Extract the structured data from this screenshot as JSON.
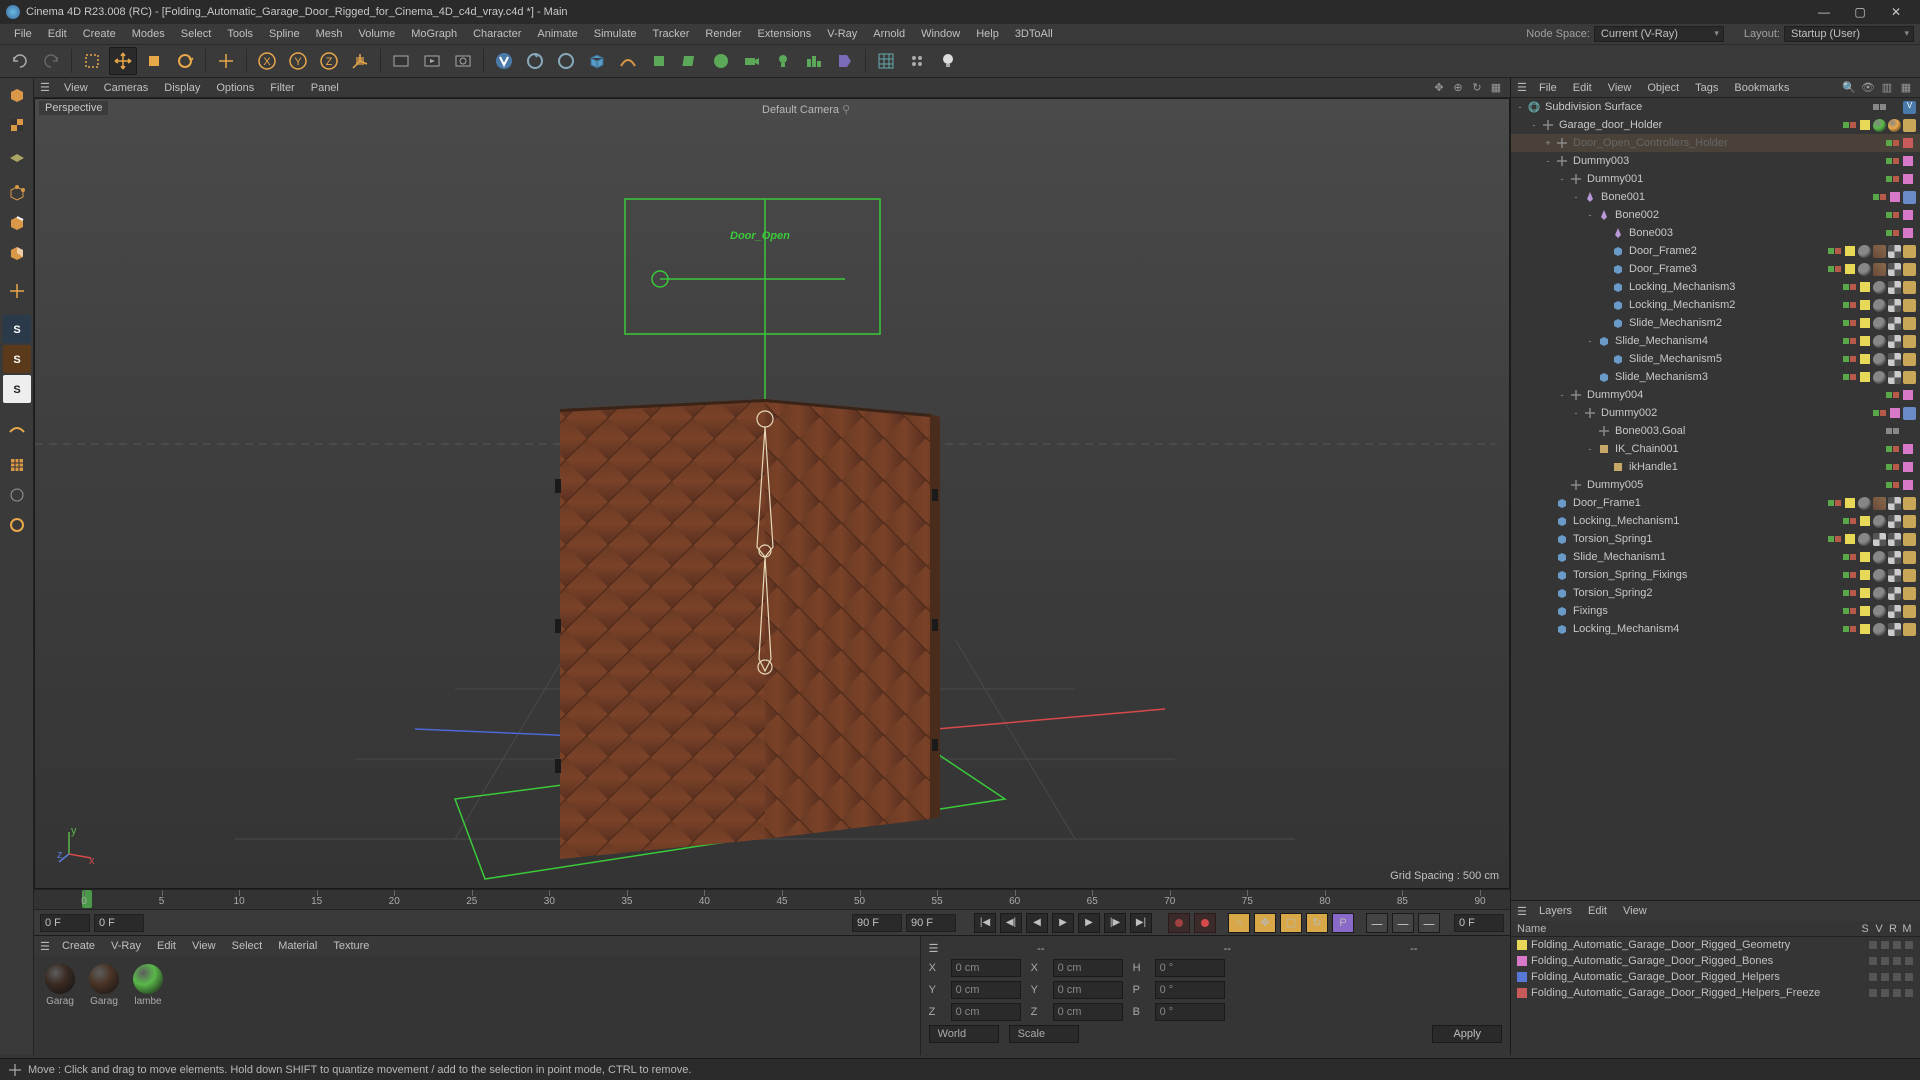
{
  "title": "Cinema 4D R23.008 (RC) - [Folding_Automatic_Garage_Door_Rigged_for_Cinema_4D_c4d_vray.c4d *] - Main",
  "main_menu": [
    "File",
    "Edit",
    "Create",
    "Modes",
    "Select",
    "Tools",
    "Spline",
    "Mesh",
    "Volume",
    "MoGraph",
    "Character",
    "Animate",
    "Simulate",
    "Tracker",
    "Render",
    "Extensions",
    "V-Ray",
    "Arnold",
    "Window",
    "Help",
    "3DToAll"
  ],
  "nodespace_label": "Node Space:",
  "nodespace_value": "Current (V-Ray)",
  "layout_label": "Layout:",
  "layout_value": "Startup (User)",
  "viewport_menu": [
    "View",
    "Cameras",
    "Display",
    "Options",
    "Filter",
    "Panel"
  ],
  "viewport_label": "Perspective",
  "viewport_camera": "Default Camera",
  "viewport_overlay_text": "Door_Open",
  "grid_spacing": "Grid Spacing : 500 cm",
  "timeline": {
    "start_field": "0 F",
    "start_field2": "0 F",
    "end_field": "90 F",
    "end_field2": "90 F",
    "cur_frame": "0 F",
    "ticks": [
      0,
      5,
      10,
      15,
      20,
      25,
      30,
      35,
      40,
      45,
      50,
      55,
      60,
      65,
      70,
      75,
      80,
      85,
      90
    ]
  },
  "material_menu": [
    "Create",
    "V-Ray",
    "Edit",
    "View",
    "Select",
    "Material",
    "Texture"
  ],
  "materials": [
    {
      "name": "Garag",
      "color": "#3a2a22"
    },
    {
      "name": "Garag",
      "color": "#4a3426"
    },
    {
      "name": "lambe",
      "color": "#5ab84a"
    }
  ],
  "coords": {
    "pos": {
      "X": "0 cm",
      "Y": "0 cm",
      "Z": "0 cm"
    },
    "size": {
      "X": "0 cm",
      "Y": "0 cm",
      "Z": "0 cm"
    },
    "rot": {
      "H": "0 °",
      "P": "0 °",
      "B": "0 °"
    },
    "world": "World",
    "scale": "Scale",
    "apply": "Apply"
  },
  "om_menu": [
    "File",
    "Edit",
    "View",
    "Object",
    "Tags",
    "Bookmarks"
  ],
  "om_tree": [
    {
      "indent": 0,
      "toggle": "-",
      "icon": "subdiv",
      "name": "Subdivision Surface",
      "layer": "",
      "dots": "grey",
      "tags": [
        "vray"
      ]
    },
    {
      "indent": 1,
      "toggle": "-",
      "icon": "null",
      "name": "Garage_door_Holder",
      "layer": "#e8d858",
      "dots": "gr",
      "tags": [
        "sphere-g",
        "sphere-o",
        "dots"
      ]
    },
    {
      "indent": 2,
      "toggle": "+",
      "icon": "null",
      "name": "Door_Open_Controllers_Holder",
      "layer": "#c85a5a",
      "dots": "gr",
      "tags": [],
      "sel": true,
      "dim": true
    },
    {
      "indent": 2,
      "toggle": "-",
      "icon": "null",
      "name": "Dummy003",
      "layer": "#d878c8",
      "dots": "gr",
      "tags": []
    },
    {
      "indent": 3,
      "toggle": "-",
      "icon": "null",
      "name": "Dummy001",
      "layer": "#d878c8",
      "dots": "gr",
      "tags": []
    },
    {
      "indent": 4,
      "toggle": "-",
      "icon": "bone",
      "name": "Bone001",
      "layer": "#d878c8",
      "dots": "gr",
      "tags": [
        "ik"
      ]
    },
    {
      "indent": 5,
      "toggle": "-",
      "icon": "bone",
      "name": "Bone002",
      "layer": "#d878c8",
      "dots": "gr",
      "tags": []
    },
    {
      "indent": 6,
      "toggle": "",
      "icon": "bone",
      "name": "Bone003",
      "layer": "#d878c8",
      "dots": "gr",
      "tags": []
    },
    {
      "indent": 6,
      "toggle": "",
      "icon": "poly",
      "name": "Door_Frame2",
      "layer": "#e8d858",
      "dots": "gr",
      "tags": [
        "sphere",
        "tex",
        "chk",
        "dots"
      ]
    },
    {
      "indent": 6,
      "toggle": "",
      "icon": "poly",
      "name": "Door_Frame3",
      "layer": "#e8d858",
      "dots": "gr",
      "tags": [
        "sphere",
        "tex",
        "chk",
        "dots"
      ]
    },
    {
      "indent": 6,
      "toggle": "",
      "icon": "poly",
      "name": "Locking_Mechanism3",
      "layer": "#e8d858",
      "dots": "gr",
      "tags": [
        "sphere",
        "chk",
        "dots"
      ]
    },
    {
      "indent": 6,
      "toggle": "",
      "icon": "poly",
      "name": "Locking_Mechanism2",
      "layer": "#e8d858",
      "dots": "gr",
      "tags": [
        "sphere",
        "chk",
        "dots"
      ]
    },
    {
      "indent": 6,
      "toggle": "",
      "icon": "poly",
      "name": "Slide_Mechanism2",
      "layer": "#e8d858",
      "dots": "gr",
      "tags": [
        "sphere",
        "chk",
        "dots"
      ]
    },
    {
      "indent": 5,
      "toggle": "-",
      "icon": "poly",
      "name": "Slide_Mechanism4",
      "layer": "#e8d858",
      "dots": "gr",
      "tags": [
        "sphere",
        "chk",
        "dots"
      ]
    },
    {
      "indent": 6,
      "toggle": "",
      "icon": "poly",
      "name": "Slide_Mechanism5",
      "layer": "#e8d858",
      "dots": "gr",
      "tags": [
        "sphere",
        "chk",
        "dots"
      ]
    },
    {
      "indent": 5,
      "toggle": "",
      "icon": "poly",
      "name": "Slide_Mechanism3",
      "layer": "#e8d858",
      "dots": "gr",
      "tags": [
        "sphere",
        "chk",
        "dots"
      ]
    },
    {
      "indent": 3,
      "toggle": "-",
      "icon": "null",
      "name": "Dummy004",
      "layer": "#d878c8",
      "dots": "gr",
      "tags": []
    },
    {
      "indent": 4,
      "toggle": "-",
      "icon": "null",
      "name": "Dummy002",
      "layer": "#d878c8",
      "dots": "gr",
      "tags": [
        "dots-b"
      ]
    },
    {
      "indent": 5,
      "toggle": "",
      "icon": "null",
      "name": "Bone003.Goal",
      "layer": "",
      "dots": "grey",
      "tags": []
    },
    {
      "indent": 5,
      "toggle": "-",
      "icon": "ik",
      "name": "IK_Chain001",
      "layer": "#d878c8",
      "dots": "gr",
      "tags": []
    },
    {
      "indent": 6,
      "toggle": "",
      "icon": "ik",
      "name": "ikHandle1",
      "layer": "#d878c8",
      "dots": "gr",
      "tags": []
    },
    {
      "indent": 3,
      "toggle": "",
      "icon": "null",
      "name": "Dummy005",
      "layer": "#d878c8",
      "dots": "gr",
      "tags": []
    },
    {
      "indent": 2,
      "toggle": "",
      "icon": "poly",
      "name": "Door_Frame1",
      "layer": "#e8d858",
      "dots": "gr",
      "tags": [
        "sphere",
        "tex",
        "chk",
        "dots"
      ]
    },
    {
      "indent": 2,
      "toggle": "",
      "icon": "poly",
      "name": "Locking_Mechanism1",
      "layer": "#e8d858",
      "dots": "gr",
      "tags": [
        "sphere",
        "chk",
        "dots"
      ]
    },
    {
      "indent": 2,
      "toggle": "",
      "icon": "poly",
      "name": "Torsion_Spring1",
      "layer": "#e8d858",
      "dots": "gr",
      "tags": [
        "sphere",
        "chk2",
        "chk",
        "dots"
      ]
    },
    {
      "indent": 2,
      "toggle": "",
      "icon": "poly",
      "name": "Slide_Mechanism1",
      "layer": "#e8d858",
      "dots": "gr",
      "tags": [
        "sphere",
        "chk",
        "dots"
      ]
    },
    {
      "indent": 2,
      "toggle": "",
      "icon": "poly",
      "name": "Torsion_Spring_Fixings",
      "layer": "#e8d858",
      "dots": "gr",
      "tags": [
        "sphere",
        "chk",
        "dots"
      ]
    },
    {
      "indent": 2,
      "toggle": "",
      "icon": "poly",
      "name": "Torsion_Spring2",
      "layer": "#e8d858",
      "dots": "gr",
      "tags": [
        "sphere",
        "chk",
        "dots"
      ]
    },
    {
      "indent": 2,
      "toggle": "",
      "icon": "poly",
      "name": "Fixings",
      "layer": "#e8d858",
      "dots": "gr",
      "tags": [
        "sphere",
        "chk",
        "dots"
      ]
    },
    {
      "indent": 2,
      "toggle": "",
      "icon": "poly",
      "name": "Locking_Mechanism4",
      "layer": "#e8d858",
      "dots": "gr",
      "tags": [
        "sphere",
        "chk",
        "dots"
      ]
    }
  ],
  "layers_menu": [
    "Layers",
    "Edit",
    "View"
  ],
  "layers_header": {
    "name": "Name",
    "flags": [
      "S",
      "V",
      "R",
      "M"
    ]
  },
  "layers": [
    {
      "color": "#e8d858",
      "name": "Folding_Automatic_Garage_Door_Rigged_Geometry"
    },
    {
      "color": "#d878c8",
      "name": "Folding_Automatic_Garage_Door_Rigged_Bones"
    },
    {
      "color": "#5878d8",
      "name": "Folding_Automatic_Garage_Door_Rigged_Helpers"
    },
    {
      "color": "#c85a5a",
      "name": "Folding_Automatic_Garage_Door_Rigged_Helpers_Freeze"
    }
  ],
  "status": "Move : Click and drag to move elements. Hold down SHIFT to quantize movement / add to the selection in point mode, CTRL to remove."
}
